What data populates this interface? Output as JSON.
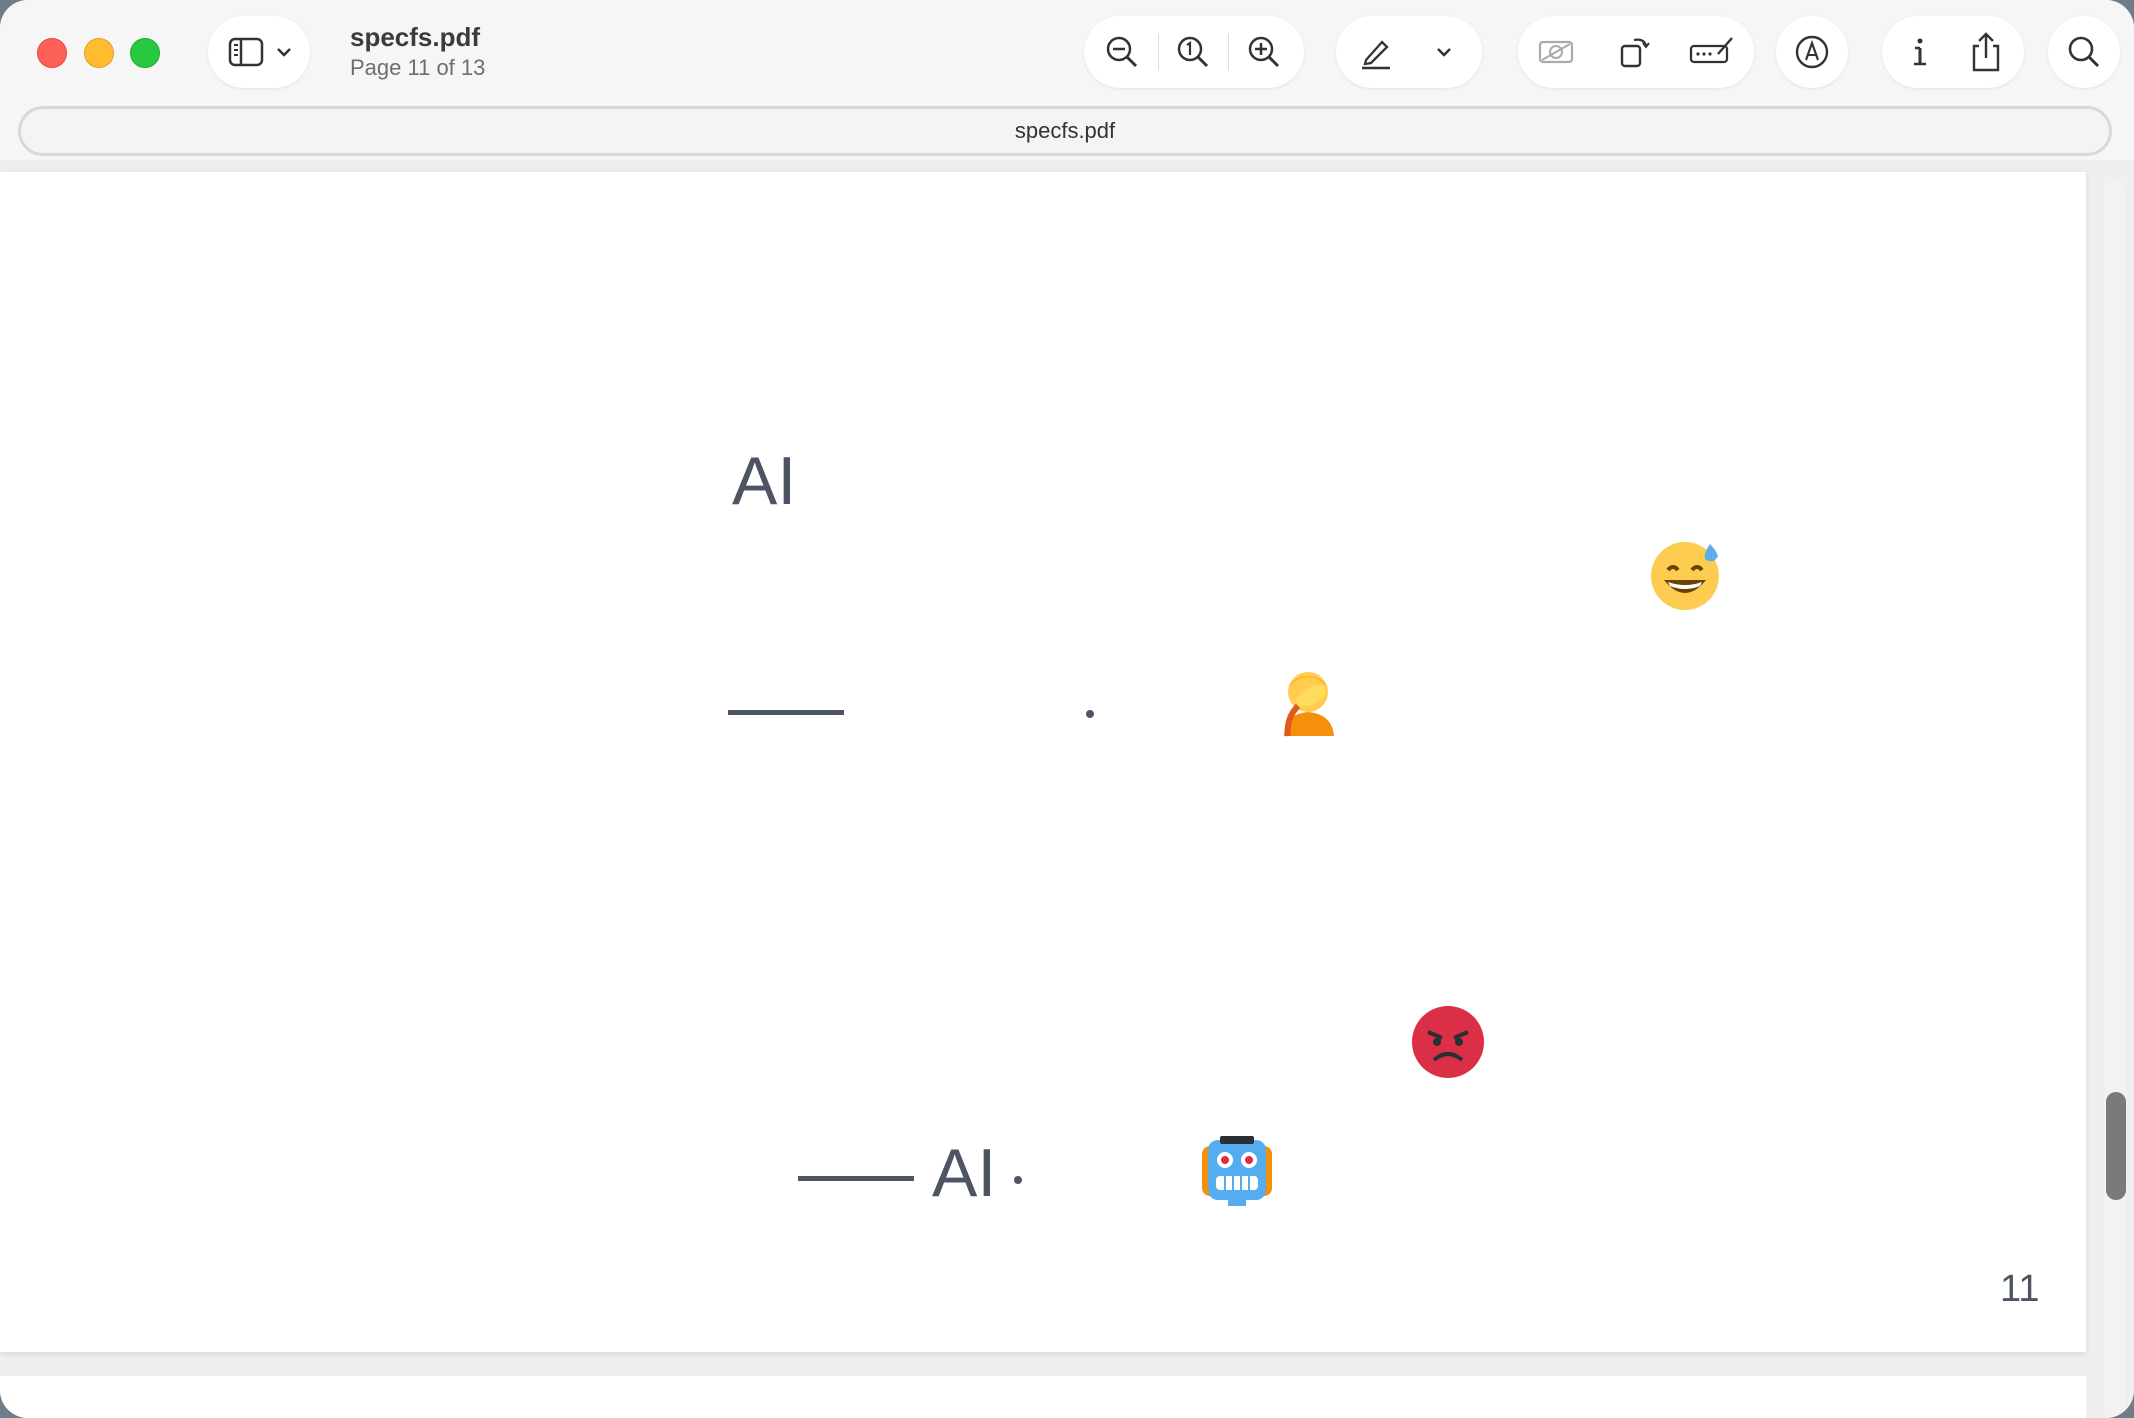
{
  "window": {
    "file_name": "specfs.pdf",
    "page_status": "Page 11 of 13",
    "address": "specfs.pdf"
  },
  "toolbar": {
    "icons": [
      "sidebar-toggle-icon",
      "chevron-down-icon",
      "zoom-out-icon",
      "actual-size-icon",
      "zoom-in-icon",
      "highlight-pen-icon",
      "chevron-down-icon",
      "redact-icon",
      "rotate-icon",
      "form-fill-icon",
      "markup-icon",
      "info-icon",
      "share-icon",
      "search-icon"
    ]
  },
  "page": {
    "heading_top": "AI",
    "bottom_ai": "AI",
    "page_number": "11",
    "emojis": [
      "grinning-sweat-emoji",
      "facepalm-emoji",
      "angry-face-emoji",
      "robot-emoji"
    ]
  },
  "colors": {
    "text": "#4c5561",
    "accent_close": "#fe5f57",
    "accent_minimize": "#febc2e",
    "accent_zoom": "#28c840"
  }
}
